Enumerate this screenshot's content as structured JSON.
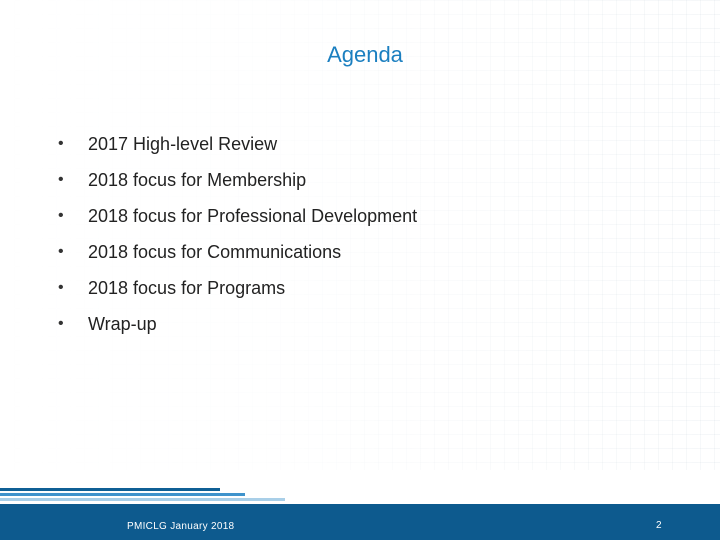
{
  "slide": {
    "title": "Agenda",
    "items": [
      "2017 High-level Review",
      "2018 focus for Membership",
      "2018 focus for Professional Development",
      "2018 focus for Communications",
      "2018 focus for Programs",
      "Wrap-up"
    ],
    "bullet": "•"
  },
  "footer": {
    "text": "PMICLG January 2018",
    "page_number": "2"
  },
  "colors": {
    "title": "#1b7fc0",
    "footer_bar": "#0d5a8e",
    "stripe_dark": "#0f5f95",
    "stripe_mid": "#3f93cc",
    "stripe_light": "#a9cfe8"
  }
}
